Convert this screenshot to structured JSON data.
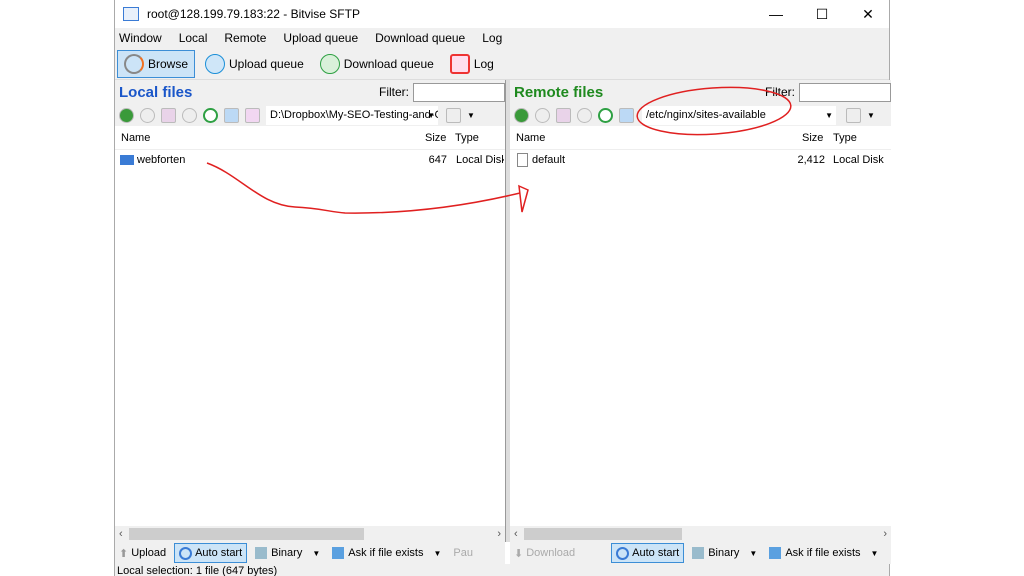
{
  "window": {
    "title": "root@128.199.79.183:22 - Bitvise SFTP",
    "minimize": "—",
    "maximize": "☐",
    "close": "✕"
  },
  "menu": [
    "Window",
    "Local",
    "Remote",
    "Upload queue",
    "Download queue",
    "Log"
  ],
  "toolbar": {
    "browse": "Browse",
    "upload_queue": "Upload queue",
    "download_queue": "Download queue",
    "log": "Log"
  },
  "local": {
    "title": "Local files",
    "title_color": "#1a56c9",
    "filter_label": "Filter:",
    "filter_value": "",
    "path": "D:\\Dropbox\\My-SEO-Testing-and-C",
    "columns": [
      "Name",
      "Size",
      "Type"
    ],
    "rows": [
      {
        "name": "webforten",
        "size": "647",
        "type": "Local Disk"
      }
    ],
    "upload": "Upload",
    "auto_start": "Auto start",
    "binary": "Binary",
    "ask": "Ask if file exists",
    "pause": "Pau"
  },
  "remote": {
    "title": "Remote files",
    "title_color": "#1f8a1f",
    "filter_label": "Filter:",
    "filter_value": "",
    "path": "/etc/nginx/sites-available",
    "columns": [
      "Name",
      "Size",
      "Type"
    ],
    "rows": [
      {
        "name": "default",
        "size": "2,412",
        "type": "Local Disk"
      }
    ],
    "download": "Download",
    "auto_start": "Auto start",
    "binary": "Binary",
    "ask": "Ask if file exists"
  },
  "status": "Local selection: 1 file (647 bytes)",
  "annotation_color": "#e02020"
}
